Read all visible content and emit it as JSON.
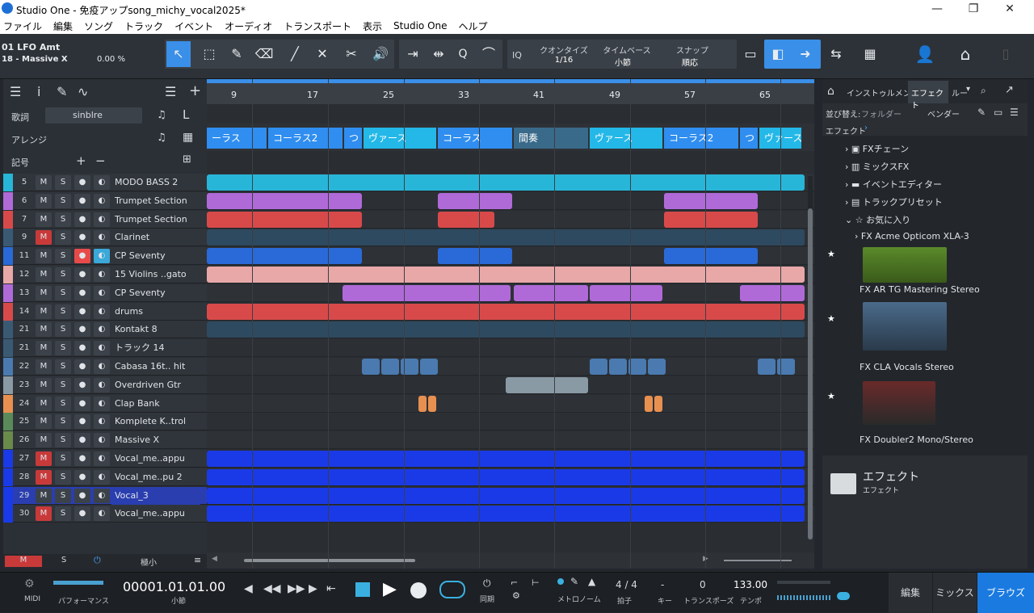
{
  "window": {
    "title": "Studio One - 免疫アップsong_michy_vocal2025*"
  },
  "menu": [
    "ファイル",
    "編集",
    "ソング",
    "トラック",
    "イベント",
    "オーディオ",
    "トランスポート",
    "表示",
    "Studio One",
    "ヘルプ"
  ],
  "toolbar": {
    "inst_name": "01 LFO Amt",
    "inst_sub": "18 - Massive X",
    "inst_value": "0.00 %",
    "quantize_label": "クオンタイズ",
    "quantize_value": "1/16",
    "timebase_label": "タイムベース",
    "timebase_value": "小節",
    "snap_label": "スナップ",
    "snap_value": "順応",
    "iq": "IQ",
    "q": "Q"
  },
  "panel": {
    "lyrics": "歌詞",
    "lyrics_value": "sinblre",
    "arrange": "アレンジ",
    "marker": "記号"
  },
  "ruler": [
    "9",
    "17",
    "25",
    "33",
    "41",
    "49",
    "57",
    "65"
  ],
  "sections": [
    {
      "label": "ーラス",
      "color": "#2f8ef0"
    },
    {
      "label": "コーラス2",
      "color": "#2f8ef0"
    },
    {
      "label": "つ",
      "color": "#2f8ef0"
    },
    {
      "label": "ヴァース",
      "color": "#23b8e8"
    },
    {
      "label": "コーラス",
      "color": "#2f8ef0"
    },
    {
      "label": "間奏",
      "color": "#3a6a8a"
    },
    {
      "label": "ヴァース",
      "color": "#23b8e8"
    },
    {
      "label": "コーラス2",
      "color": "#2f8ef0"
    },
    {
      "label": "つ",
      "color": "#2f8ef0"
    },
    {
      "label": "ヴァース",
      "color": "#23b8e8"
    }
  ],
  "tracks": [
    {
      "num": "5",
      "name": "MODO BASS 2",
      "color": "#28b6d8",
      "m": false,
      "rec": false
    },
    {
      "num": "6",
      "name": "Trumpet Section",
      "color": "#b06ad8",
      "m": false,
      "rec": false
    },
    {
      "num": "7",
      "name": "Trumpet Section",
      "color": "#d84a4a",
      "m": false,
      "rec": false
    },
    {
      "num": "9",
      "name": "Clarinet",
      "color": "#3a5a74",
      "m": true,
      "rec": false
    },
    {
      "num": "11",
      "name": "CP Seventy",
      "color": "#2a6ad8",
      "m": false,
      "rec": true
    },
    {
      "num": "12",
      "name": "15 Violins ..gato",
      "color": "#e8a8a8",
      "m": false,
      "rec": false
    },
    {
      "num": "13",
      "name": "CP Seventy",
      "color": "#b06ad8",
      "m": false,
      "rec": false
    },
    {
      "num": "14",
      "name": "drums",
      "color": "#d84a4a",
      "m": false,
      "rec": false
    },
    {
      "num": "21",
      "name": "Kontakt 8",
      "color": "#3a5a74",
      "m": false,
      "rec": false
    },
    {
      "num": "21",
      "name": "トラック 14",
      "color": "#3a5a74",
      "m": false,
      "rec": false
    },
    {
      "num": "22",
      "name": "Cabasa 16t.. hit",
      "color": "#4a7ab0",
      "m": false,
      "rec": false
    },
    {
      "num": "23",
      "name": "Overdriven Gtr",
      "color": "#8a9aa4",
      "m": false,
      "rec": false
    },
    {
      "num": "24",
      "name": "Clap Bank",
      "color": "#e89050",
      "m": false,
      "rec": false
    },
    {
      "num": "25",
      "name": "Komplete K..trol",
      "color": "#5a8a5a",
      "m": false,
      "rec": false
    },
    {
      "num": "26",
      "name": "Massive X",
      "color": "#6a8a4a",
      "m": false,
      "rec": false
    },
    {
      "num": "27",
      "name": "Vocal_me..appu",
      "color": "#1a3ae8",
      "m": true,
      "rec": false
    },
    {
      "num": "28",
      "name": "Vocal_me..pu 2",
      "color": "#1a3ae8",
      "m": true,
      "rec": false
    },
    {
      "num": "29",
      "name": "Vocal_3",
      "color": "#1a3ae8",
      "m": false,
      "rec": false
    },
    {
      "num": "30",
      "name": "Vocal_me..appu",
      "color": "#1a3ae8",
      "m": true,
      "rec": false
    }
  ],
  "footer": {
    "m": "M",
    "s": "S",
    "size": "極小"
  },
  "browser": {
    "tab_inst": "インストゥルメント",
    "tab_fx": "エフェクト",
    "tab_loop": "ルー",
    "sort": "並び替え:",
    "sort_folder": "フォルダー",
    "sort_vendor": "ベンダー",
    "crumb": "エフェクト",
    "items": [
      "FXチェーン",
      "ミックスFX",
      "イベントエディター",
      "トラックプリセット",
      "お気に入り"
    ],
    "fav": [
      "Acme Opticom XLA-3",
      "AR TG Mastering Stereo",
      "CLA Vocals Stereo",
      "Doubler2 Mono/Stereo"
    ],
    "folder_title": "エフェクト",
    "folder_sub": "エフェクト"
  },
  "transport": {
    "midi": "MIDI",
    "perf": "パフォーマンス",
    "time": "00001.01.01.00",
    "time_unit": "小節",
    "sync": "同期",
    "metro": "メトロノーム",
    "sig": "4 / 4",
    "sig_lbl": "拍子",
    "key": "-",
    "key_lbl": "キー",
    "transpose": "0",
    "transpose_lbl": "トランスポーズ",
    "tempo": "133.00",
    "tempo_lbl": "テンポ",
    "edit": "編集",
    "mix": "ミックス",
    "browse": "ブラウズ"
  }
}
